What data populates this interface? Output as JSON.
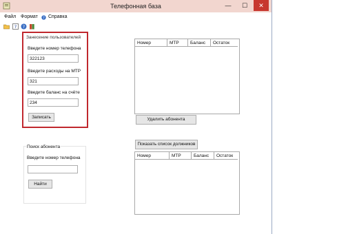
{
  "window": {
    "title": "Телефонная база",
    "controls": {
      "minimize": "—",
      "maximize": "☐",
      "close": "✕"
    }
  },
  "menu": [
    "Файл",
    "Формат",
    "Справка"
  ],
  "toolbar_icons": [
    "folder-icon",
    "help-icon",
    "info-icon",
    "book-icon"
  ],
  "add_user": {
    "group_title": "Занесение пользователей",
    "phone_label": "Введите номер телефона",
    "phone_value": "322123",
    "expense_label": "Введите расходы на МТР",
    "expense_value": "321",
    "balance_label": "Введите баланс на счёте",
    "balance_value": "234",
    "save_button": "Записать"
  },
  "search": {
    "group_title": "Поиск абонента",
    "phone_label": "Введите номер телефона",
    "phone_value": "",
    "find_button": "Найти"
  },
  "grid_top": {
    "columns": [
      "Номер",
      "МТР",
      "Баланс",
      "Остаток"
    ]
  },
  "delete_button": "Удалить абонента",
  "debtors_button": "Показать список должников",
  "grid_bottom": {
    "columns": [
      "Номер",
      "МТР",
      "Баланс",
      "Остаток"
    ]
  },
  "colors": {
    "highlight_border": "#c0272d",
    "titlebar": "#f2d6cf",
    "close": "#c7372f"
  }
}
